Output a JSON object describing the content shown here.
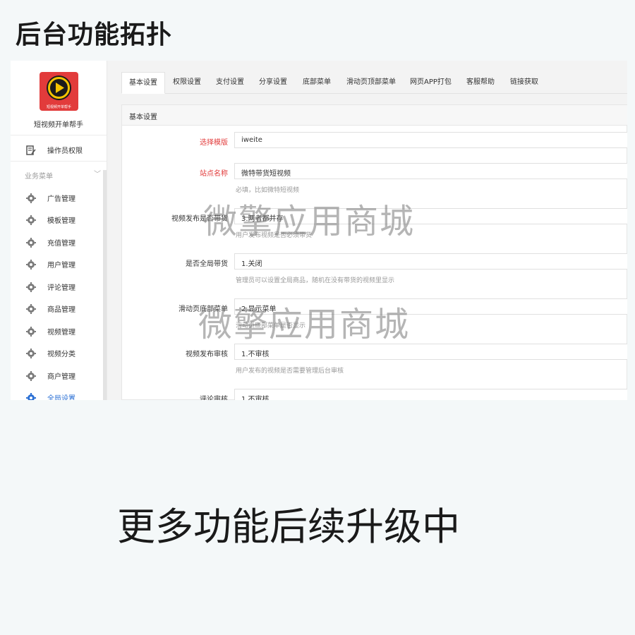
{
  "page_title": "后台功能拓扑",
  "sidebar": {
    "logo_text": "短视频开单帮手",
    "app_name": "短视频开单帮手",
    "operator_item": "操作员权限",
    "section_label": "业务菜单",
    "items": [
      {
        "label": "广告管理",
        "icon": "gear-icon"
      },
      {
        "label": "模板管理",
        "icon": "gear-icon"
      },
      {
        "label": "充值管理",
        "icon": "gear-icon"
      },
      {
        "label": "用户管理",
        "icon": "gear-icon"
      },
      {
        "label": "评论管理",
        "icon": "gear-icon"
      },
      {
        "label": "商品管理",
        "icon": "gear-icon"
      },
      {
        "label": "视频管理",
        "icon": "gear-icon"
      },
      {
        "label": "视频分类",
        "icon": "gear-icon"
      },
      {
        "label": "商户管理",
        "icon": "gear-icon"
      },
      {
        "label": "全局设置",
        "icon": "gear-icon",
        "active": true
      }
    ]
  },
  "tabs": [
    "基本设置",
    "权限设置",
    "支付设置",
    "分享设置",
    "底部菜单",
    "滑动页顶部菜单",
    "网页APP打包",
    "客服帮助",
    "链接获取"
  ],
  "panel": {
    "title": "基本设置",
    "fields": [
      {
        "label": "选择模版",
        "value": "iweite",
        "hint": "",
        "required": true
      },
      {
        "label": "站点名称",
        "value": "微特带货短视频",
        "hint": "必填，比如微特短视频",
        "required": true
      },
      {
        "label": "视频发布是否带货",
        "value": "3.两者都并存",
        "hint": "用户发布视频是否必须带货",
        "required": false
      },
      {
        "label": "是否全局带货",
        "value": "1.关闭",
        "hint": "管理员可以设置全局商品，随机在没有带货的视频里显示",
        "required": false
      },
      {
        "label": "滑动页底部菜单",
        "value": "2.显示菜单",
        "hint": "滑动页底部菜单是否显示",
        "required": false
      },
      {
        "label": "视频发布审核",
        "value": "1.不审核",
        "hint": "用户发布的视频是否需要管理后台审核",
        "required": false
      },
      {
        "label": "评论审核",
        "value": "1.不审核",
        "hint": "",
        "required": false
      }
    ]
  },
  "watermark": "微擎应用商城",
  "footer_caption": "更多功能后续升级中",
  "colors": {
    "accent": "#2a6fd4",
    "required": "#e23b3b",
    "logo_bg": "#e23b3b"
  }
}
